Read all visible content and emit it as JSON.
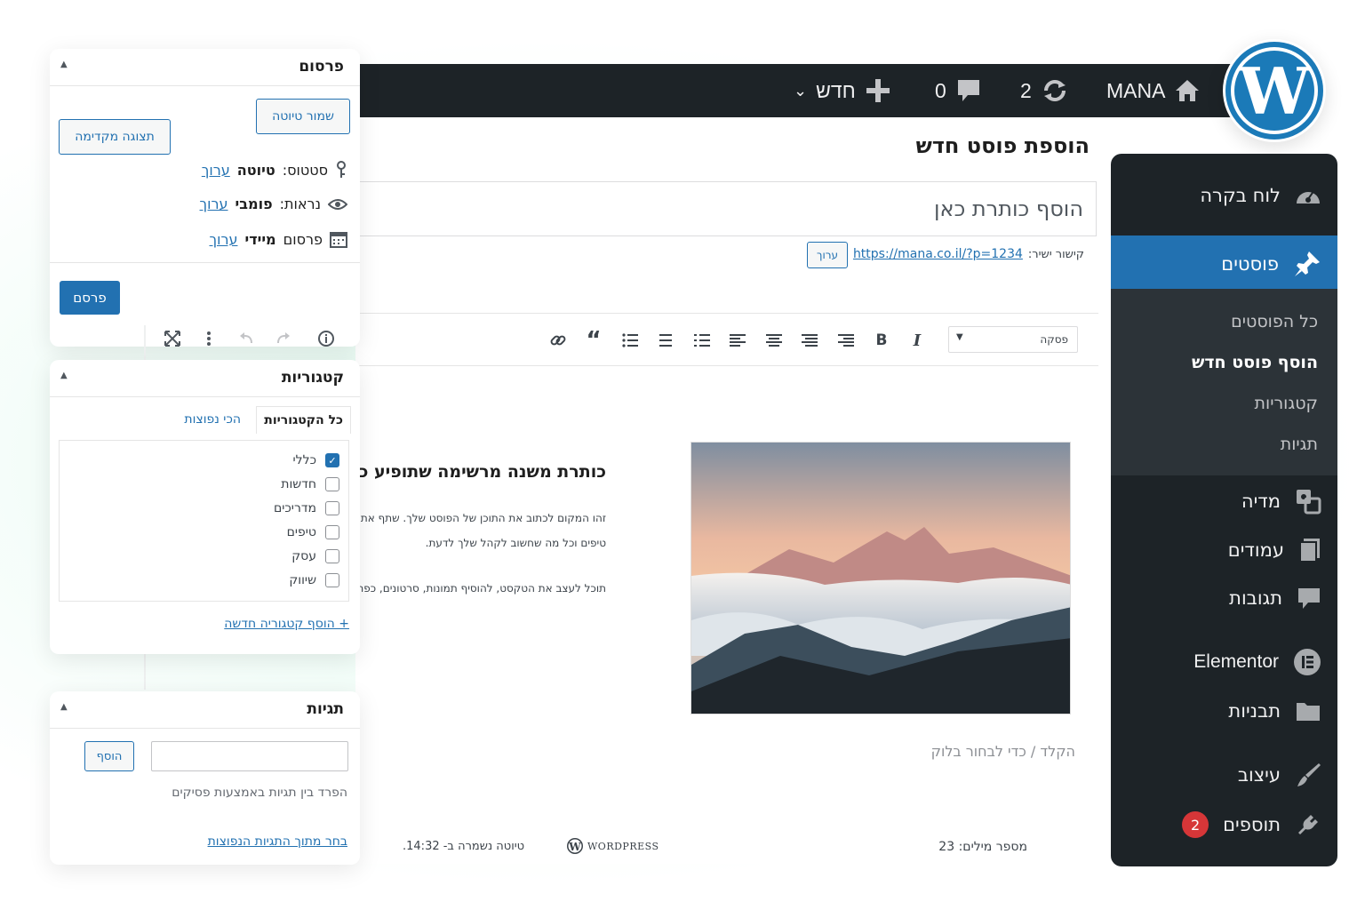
{
  "topbar": {
    "site_name": "MANA",
    "updates_count": "2",
    "comments_count": "0",
    "new_label": "חדש"
  },
  "editor": {
    "page_title": "הוספת פוסט חדש",
    "title_placeholder": "הוסף כותרת כאן",
    "permalink_label": "קישור ישיר:",
    "permalink_url": "https://mana.co.il/?p=1234",
    "permalink_edit": "ערוך",
    "paragraph_select": "פסקה",
    "content_heading": "כותרת משנה מרשימה שתופיע כאן",
    "content_lines": [
      "זהו המקום לכתוב את התוכן של הפוסט שלך. שתף את",
      "טיפים וכל מה שחשוב לקהל שלך לדעת.",
      "תוכל לעצב את הטקסט, להוסיף תמונות, סרטונים, כפתורים"
    ],
    "block_placeholder": "הקלד / כדי לבחור בלוק",
    "word_count": "מספר מילים: 23",
    "wordpress_mark": "WordPress",
    "draft_saved": "טיוטה נשמרה ב- 14:32."
  },
  "sidebar": {
    "dashboard": "לוח בקרה",
    "posts": "פוסטים",
    "posts_sub": [
      "כל הפוסטים",
      "הוסף פוסט חדש",
      "קטגוריות",
      "תגיות"
    ],
    "media": "מדיה",
    "pages": "עמודים",
    "comments": "תגובות",
    "elementor": "Elementor",
    "templates": "תבניות",
    "appearance": "עיצוב",
    "plugins": "תוספים",
    "plugins_badge": "2"
  },
  "publish_panel": {
    "title": "פרסום",
    "save_draft": "שמור טיוטה",
    "preview": "תצוגה מקדימה",
    "status_label": "סטטוס:",
    "status_value": "טיוטה",
    "visibility_label": "נראות:",
    "visibility_value": "פומבי",
    "schedule_label": "פרסום",
    "schedule_value": "מיידי",
    "edit": "ערוך",
    "publish_button": "פרסם"
  },
  "categories_panel": {
    "title": "קטגוריות",
    "tab_all": "כל הקטגוריות",
    "tab_popular": "הכי נפוצות",
    "items": [
      "כללי",
      "חדשות",
      "מדריכים",
      "טיפים",
      "עסק",
      "שיווק"
    ],
    "checked": [
      true,
      false,
      false,
      false,
      false,
      false
    ],
    "add_new": "+ הוסף קטגוריה חדשה"
  },
  "tags_panel": {
    "title": "תגיות",
    "add_button": "הוסף",
    "hint": "הפרד בין תגיות באמצעות פסיקים",
    "choose_link": "בחר מתוך התגיות הנפוצות"
  },
  "colors": {
    "admin_dark": "#1d2327",
    "accent_blue": "#2271b1",
    "badge_red": "#d63638"
  }
}
